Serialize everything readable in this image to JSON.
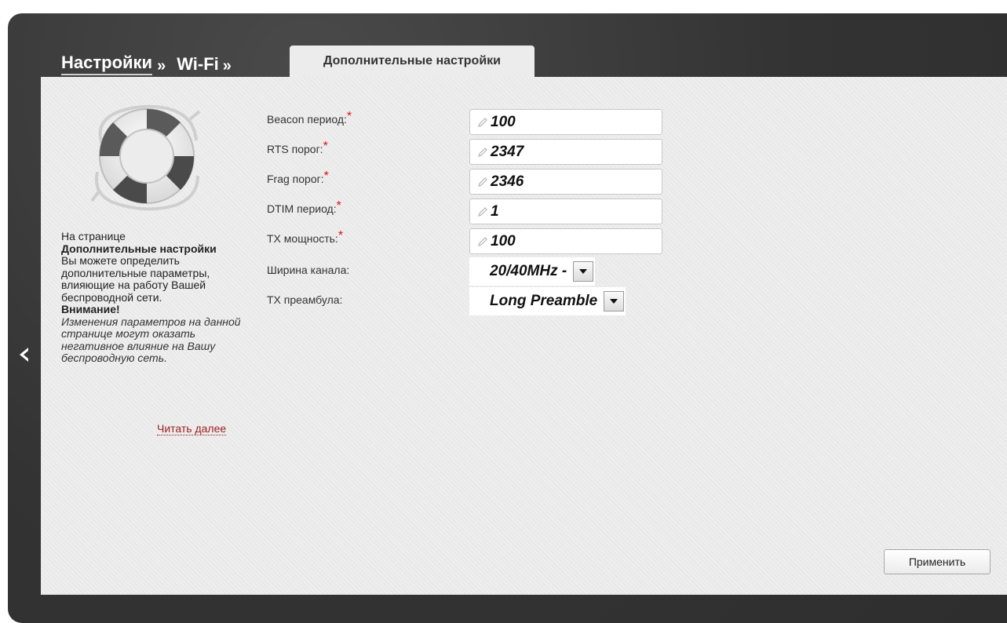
{
  "breadcrumb": {
    "items": [
      "Настройки",
      "Wi-Fi"
    ],
    "separator": "»"
  },
  "tab": {
    "active_label": "Дополнительные настройки"
  },
  "help": {
    "line1": "На странице",
    "page_name": "Дополнительные настройки",
    "description": "Вы можете определить дополнительные параметры, влияющие на работу Вашей беспроводной сети.",
    "warning_title": "Внимание!",
    "warning_text": "Изменения параметров на данной странице могут оказать негативное влияние на Вашу беспроводную сеть.",
    "read_more": "Читать далее",
    "icon": "lifebuoy-icon"
  },
  "form": {
    "required_mark": "*",
    "fields": [
      {
        "label": "Beacon период:",
        "value": "100",
        "required": true
      },
      {
        "label": "RTS порог:",
        "value": "2347",
        "required": true
      },
      {
        "label": "Frag порог:",
        "value": "2346",
        "required": true
      },
      {
        "label": "DTIM период:",
        "value": "1",
        "required": true
      },
      {
        "label": "TX мощность:",
        "value": "100",
        "required": true
      }
    ],
    "selects": [
      {
        "label": "Ширина канала:",
        "value": "20/40MHz -"
      },
      {
        "label": "TX преамбула:",
        "value": "Long Preamble"
      }
    ]
  },
  "actions": {
    "apply_label": "Применить"
  },
  "nav": {
    "back_icon": "chevron-left-icon"
  },
  "colors": {
    "frame": "#3a3a3a",
    "panel": "#ececec",
    "required": "#e01010",
    "link": "#9b1e1e"
  }
}
